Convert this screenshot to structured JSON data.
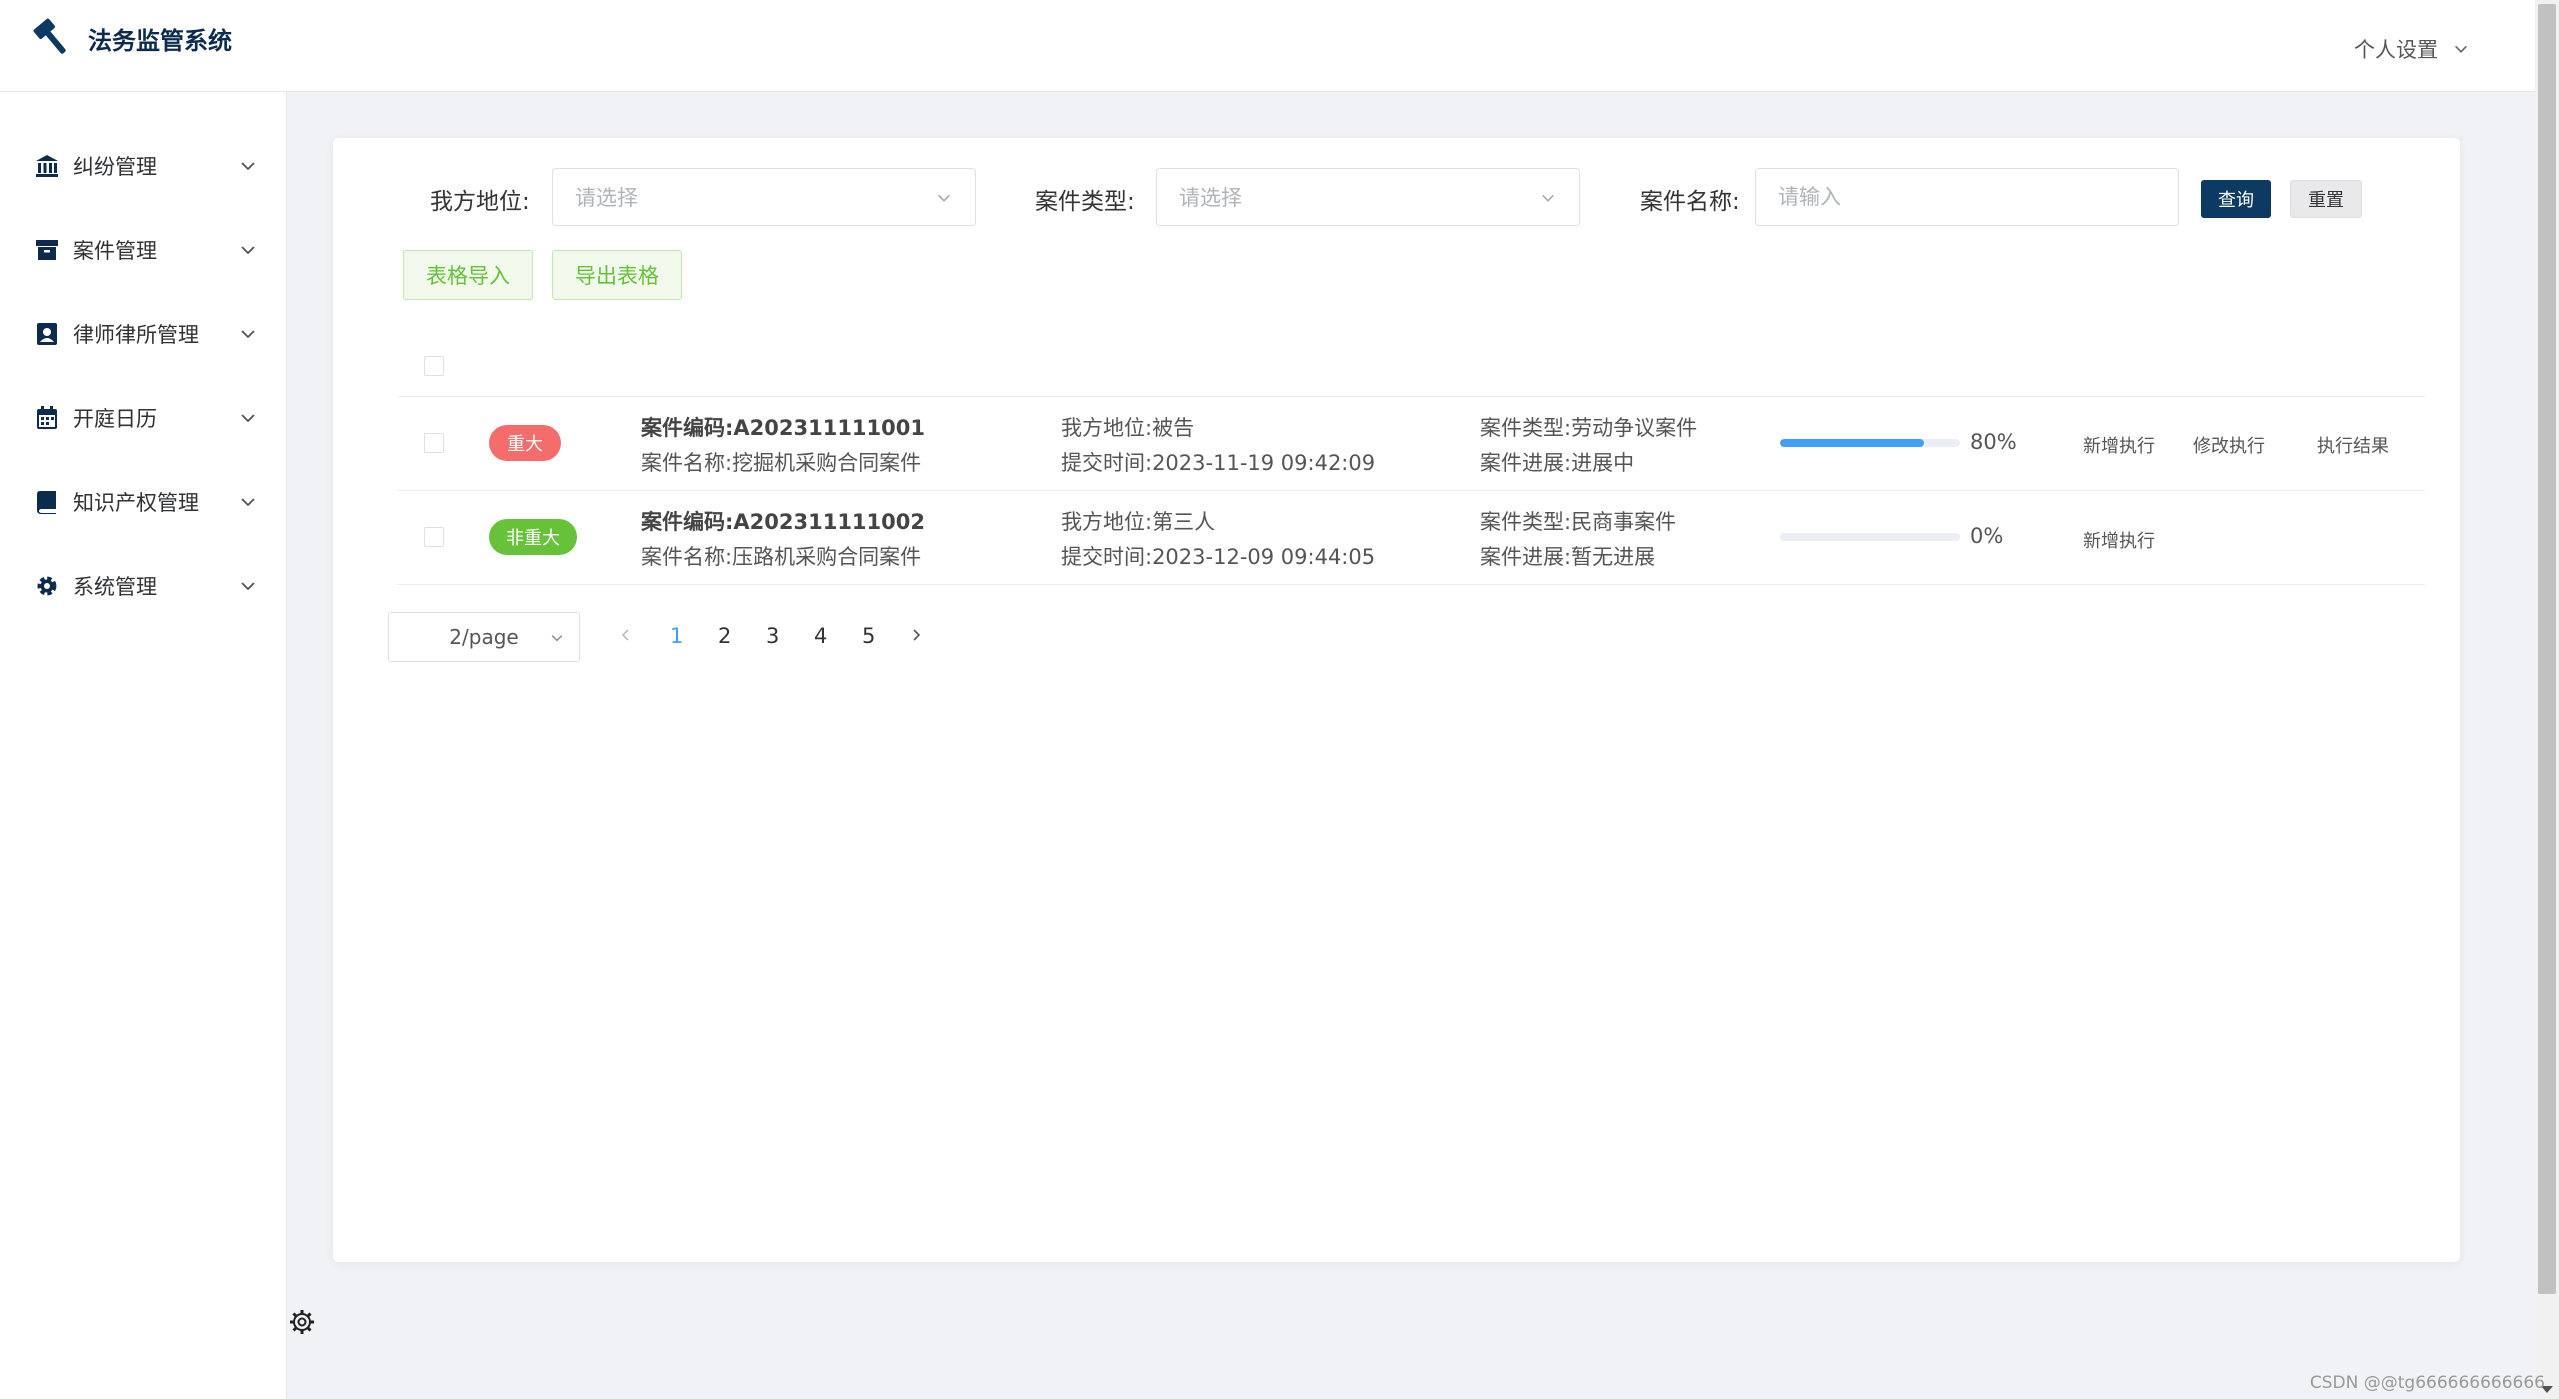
{
  "app": {
    "title": "法务监管系统"
  },
  "header": {
    "user_menu": "个人设置"
  },
  "sidebar": {
    "items": [
      {
        "label": "纠纷管理",
        "icon": "bank-icon"
      },
      {
        "label": "案件管理",
        "icon": "archive-box-icon"
      },
      {
        "label": "律师律所管理",
        "icon": "contact-card-icon"
      },
      {
        "label": "开庭日历",
        "icon": "calendar-icon"
      },
      {
        "label": "知识产权管理",
        "icon": "book-icon"
      },
      {
        "label": "系统管理",
        "icon": "gear-icon"
      }
    ]
  },
  "filters": {
    "position_label": "我方地位:",
    "position_placeholder": "请选择",
    "type_label": "案件类型:",
    "type_placeholder": "请选择",
    "name_label": "案件名称:",
    "name_placeholder": "请输入",
    "query_button": "查询",
    "reset_button": "重置",
    "import_button": "表格导入",
    "export_button": "导出表格"
  },
  "cases": [
    {
      "severity": "重大",
      "severity_color": "#f56c6c",
      "code": "案件编码:A202311111001",
      "name": "案件名称:挖掘机采购合同案件",
      "position": "我方地位:被告",
      "submit_time": "提交时间:2023-11-19 09:42:09",
      "type": "案件类型:劳动争议案件",
      "progress_text": "案件进展:进展中",
      "progress": 80,
      "progress_label": "80%",
      "actions": [
        "新增执行",
        "修改执行",
        "执行结果"
      ]
    },
    {
      "severity": "非重大",
      "severity_color": "#67c23a",
      "code": "案件编码:A202311111002",
      "name": "案件名称:压路机采购合同案件",
      "position": "我方地位:第三人",
      "submit_time": "提交时间:2023-12-09 09:44:05",
      "type": "案件类型:民商事案件",
      "progress_text": "案件进展:暂无进展",
      "progress": 0,
      "progress_label": "0%",
      "actions": [
        "新增执行"
      ]
    }
  ],
  "pagination": {
    "page_size": "2/page",
    "pages": [
      "1",
      "2",
      "3",
      "4",
      "5"
    ],
    "current": "1"
  },
  "watermark": "CSDN @@tg666666666666"
}
